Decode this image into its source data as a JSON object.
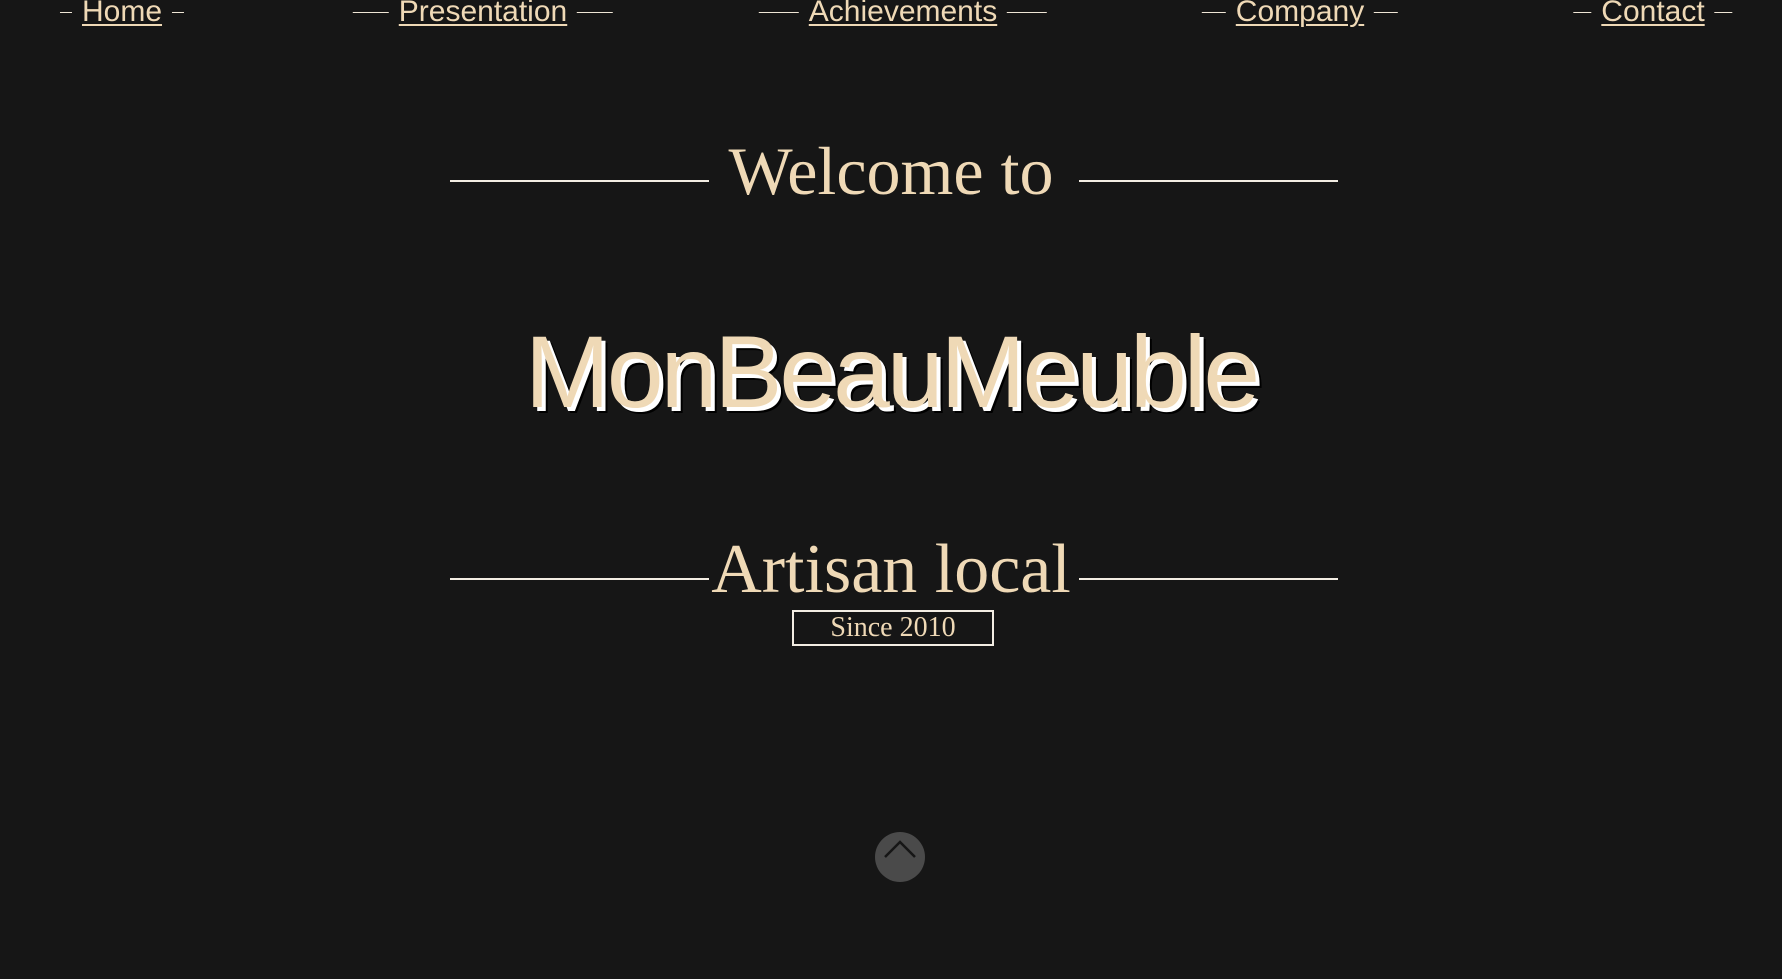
{
  "nav": {
    "items": [
      {
        "label": "Home"
      },
      {
        "label": "Presentation"
      },
      {
        "label": "Achievements"
      },
      {
        "label": "Company"
      },
      {
        "label": "Contact"
      }
    ]
  },
  "hero": {
    "welcome": "Welcome to",
    "brand": "MonBeauMeuble",
    "tagline": "Artisan local",
    "since": "Since 2010"
  },
  "controls": {
    "scroll_top_icon": "chevron-up-icon"
  },
  "colors": {
    "background": "#161616",
    "accent_text": "#efd9b6",
    "rule": "#f3ede3",
    "button": "#4a4a4a"
  }
}
